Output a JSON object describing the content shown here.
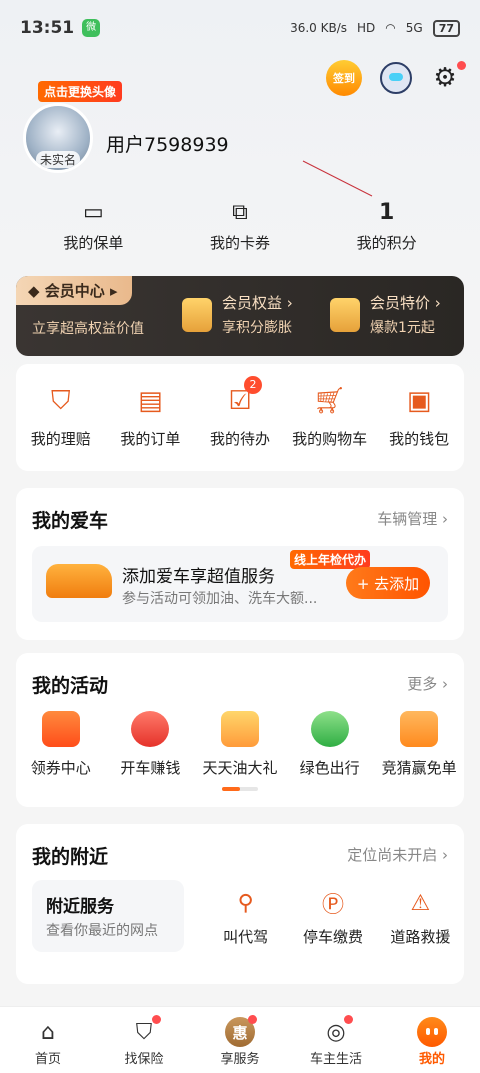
{
  "status_bar": {
    "time": "13:51",
    "app_badge": "微",
    "network": "36.0 KB/s",
    "hd": "HD",
    "signal": "5G",
    "battery": "77"
  },
  "top_actions": {
    "sign_in": "签到"
  },
  "profile": {
    "change_avatar": "点击更换头像",
    "verify_status": "未实名",
    "username": "用户7598939"
  },
  "quick_links": [
    {
      "label": "我的保单",
      "icon": "policy-icon"
    },
    {
      "label": "我的卡券",
      "icon": "coupon-icon"
    },
    {
      "label": "我的积分",
      "value": "1"
    }
  ],
  "member": {
    "center": "会员中心",
    "center_sub": "立享超高权益价值",
    "benefit_title": "会员权益 ›",
    "benefit_sub": "享积分膨胀",
    "special_title": "会员特价 ›",
    "special_sub": "爆款1元起"
  },
  "services": [
    {
      "label": "我的理赔",
      "icon": "shield-claim-icon"
    },
    {
      "label": "我的订单",
      "icon": "order-icon"
    },
    {
      "label": "我的待办",
      "icon": "todo-icon",
      "badge": "2"
    },
    {
      "label": "我的购物车",
      "icon": "cart-icon"
    },
    {
      "label": "我的钱包",
      "icon": "wallet-icon"
    }
  ],
  "my_car": {
    "title": "我的爱车",
    "manage": "车辆管理 ›",
    "promo_title": "添加爱车享超值服务",
    "promo_sub": "参与活动可领加油、洗车大额...",
    "promo_tag": "线上年检代办",
    "add_button": "+ 去添加"
  },
  "activities": {
    "title": "我的活动",
    "more": "更多 ›",
    "items": [
      {
        "label": "领券中心"
      },
      {
        "label": "开车赚钱"
      },
      {
        "label": "天天油大礼"
      },
      {
        "label": "绿色出行"
      },
      {
        "label": "竞猜赢免单"
      }
    ]
  },
  "nearby": {
    "title": "我的附近",
    "location_status": "定位尚未开启 ›",
    "box_title": "附近服务",
    "box_sub": "查看你最近的网点",
    "items": [
      {
        "label": "叫代驾"
      },
      {
        "label": "停车缴费"
      },
      {
        "label": "道路救援"
      }
    ]
  },
  "tabbar": [
    {
      "label": "首页"
    },
    {
      "label": "找保险"
    },
    {
      "label": "享服务",
      "icon_text": "惠"
    },
    {
      "label": "车主生活"
    },
    {
      "label": "我的"
    }
  ],
  "colors": {
    "accent": "#ff5a00",
    "member_bg": "#2e2a27",
    "card_bg": "#ffffff"
  }
}
